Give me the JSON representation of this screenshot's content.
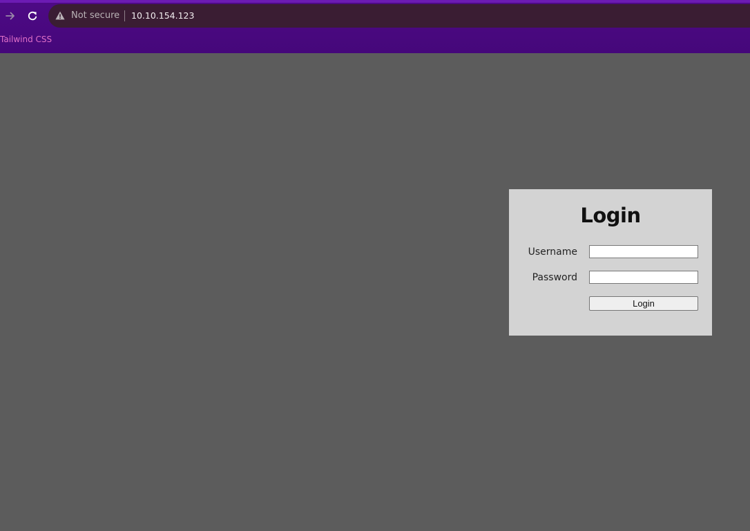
{
  "browser": {
    "security_label": "Not secure",
    "url": "10.10.154.123",
    "icons": {
      "forward": "arrow-right-icon",
      "reload": "reload-icon",
      "warning": "warning-triangle-icon"
    }
  },
  "bookmarks": [
    {
      "label": "Tailwind CSS"
    }
  ],
  "login_form": {
    "title": "Login",
    "username_label": "Username",
    "username_value": "",
    "password_label": "Password",
    "password_value": "",
    "submit_label": "Login"
  },
  "colors": {
    "page_background": "#5c5c5c",
    "panel_background": "#d3d3d3",
    "chrome_background": "#4e0a86",
    "bookmark_text": "#e070c8"
  }
}
